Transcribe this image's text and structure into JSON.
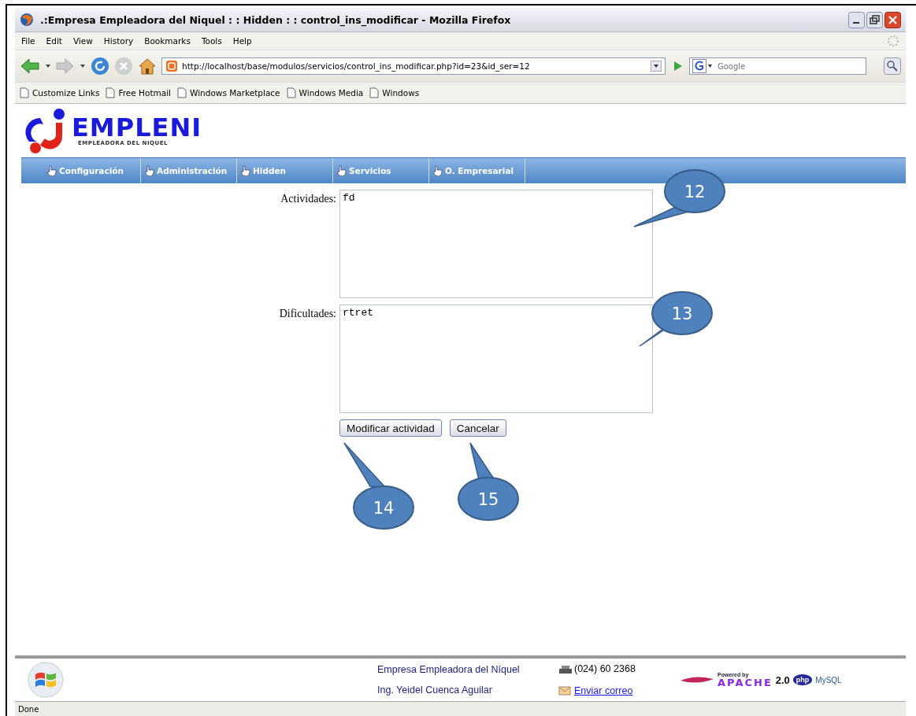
{
  "window": {
    "title": ".:Empresa Empleadora del Niquel : : Hidden : : control_ins_modificar - Mozilla Firefox"
  },
  "menu": [
    "File",
    "Edit",
    "View",
    "History",
    "Bookmarks",
    "Tools",
    "Help"
  ],
  "navigation": {
    "url": "http://localhost/base/modulos/servicios/control_ins_modificar.php?id=23&id_ser=12",
    "search_placeholder": "Google"
  },
  "bookmarks": [
    "Customize Links",
    "Free Hotmail",
    "Windows Marketplace",
    "Windows Media",
    "Windows"
  ],
  "site": {
    "logo": "EMPLENI",
    "tagline": "EMPLEADORA DEL NIQUEL",
    "nav": [
      "Configuración",
      "Administración",
      "Hidden",
      "Servicios",
      "O. Empresarial"
    ]
  },
  "form": {
    "fields": [
      {
        "label": "Actividades:",
        "value": "fd"
      },
      {
        "label": "Dificultades:",
        "value": "rtret"
      }
    ],
    "buttons": [
      "Modificar actividad",
      "Cancelar"
    ]
  },
  "callouts": [
    "12",
    "13",
    "14",
    "15"
  ],
  "footer": {
    "company": "Empresa Empleadora del Níquel",
    "author": "Ing. Yeidel Cuenca Aguilar",
    "phone": "(024) 60 2368",
    "email": "Enviar correo",
    "powered": {
      "by": "Powered by",
      "name": "APACHE",
      "version": "2.0",
      "php": "php",
      "mysql": "MySQL"
    }
  },
  "status_bar": "Done"
}
